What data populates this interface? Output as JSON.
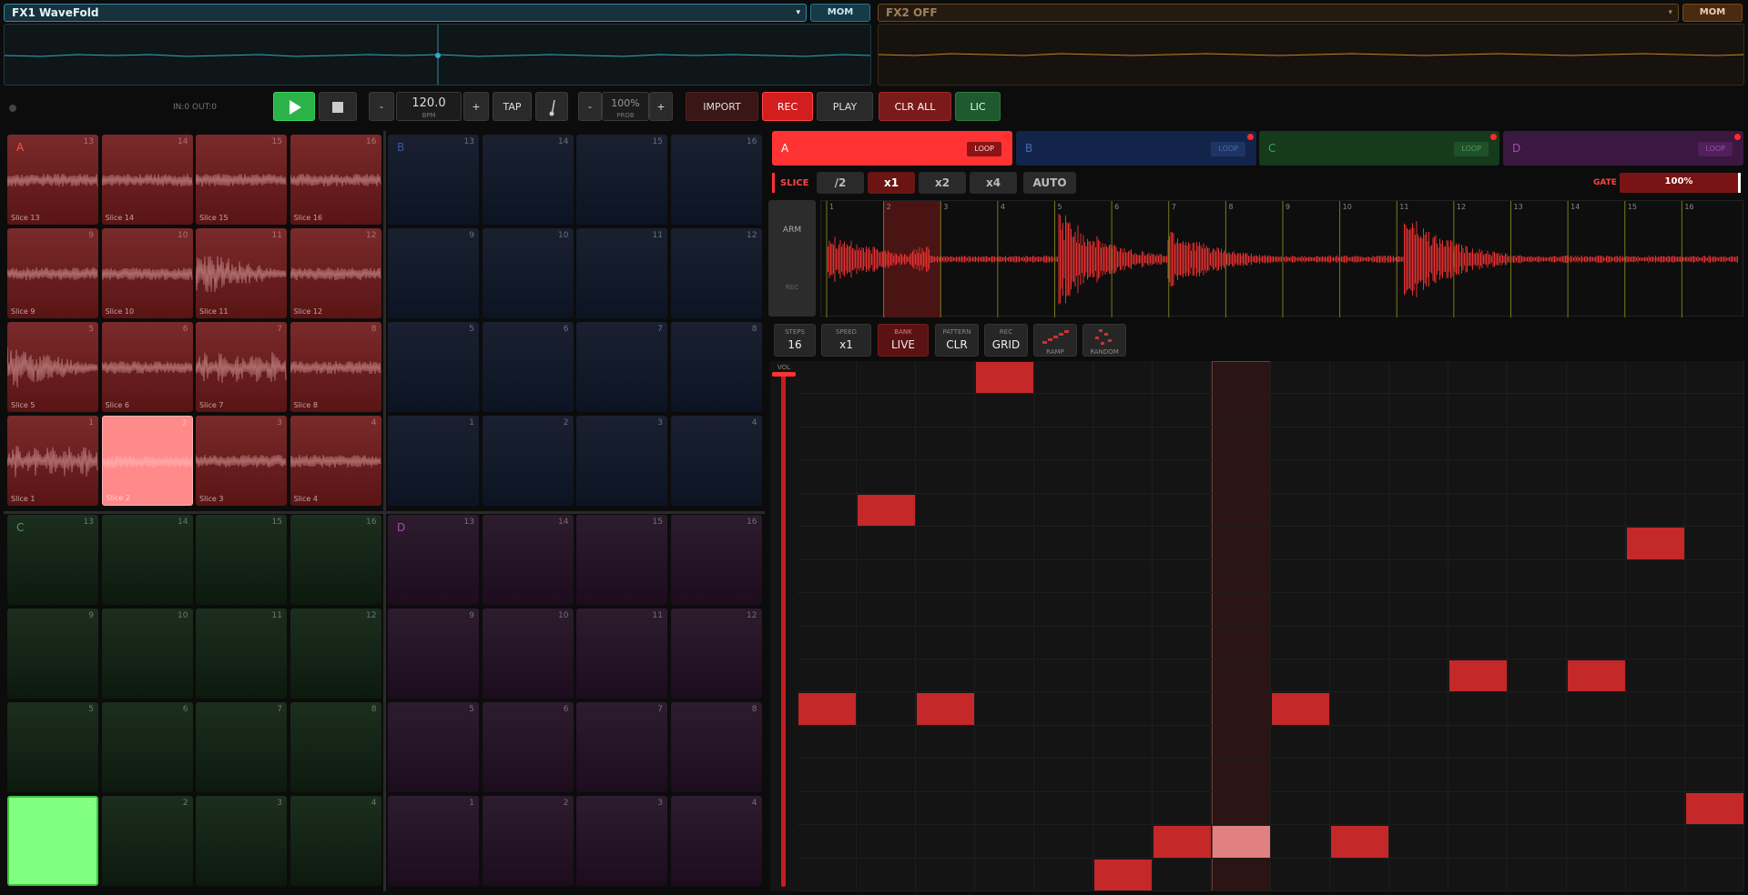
{
  "fx1": {
    "label": "FX1  WaveFold",
    "mom": "MOM"
  },
  "fx2": {
    "label": "FX2  OFF",
    "mom": "MOM"
  },
  "transport": {
    "io": "IN:0 OUT:0",
    "bpm_minus": "-",
    "bpm": "120.0",
    "bpm_unit": "BPM",
    "bpm_plus": "+",
    "tap": "TAP",
    "prob_minus": "-",
    "prob": "100%",
    "prob_unit": "PROB",
    "prob_plus": "+",
    "import": "IMPORT",
    "rec": "REC",
    "play": "PLAY",
    "clr_all": "CLR ALL",
    "lic": "LIC"
  },
  "banks": {
    "a_letter": "A",
    "b_letter": "B",
    "c_letter": "C",
    "d_letter": "D",
    "pad_numbers": [
      "13",
      "14",
      "15",
      "16",
      "9",
      "10",
      "11",
      "12",
      "5",
      "6",
      "7",
      "8",
      "1",
      "2",
      "3",
      "4"
    ],
    "a_slices": [
      "Slice 13",
      "Slice 14",
      "Slice 15",
      "Slice 16",
      "Slice 9",
      "Slice 10",
      "Slice 11",
      "Slice 12",
      "Slice 5",
      "Slice 6",
      "Slice 7",
      "Slice 8",
      "Slice 1",
      "Slice 2",
      "Slice 3",
      "Slice 4"
    ]
  },
  "tabs": [
    {
      "letter": "A",
      "loop": "LOOP"
    },
    {
      "letter": "B",
      "loop": "LOOP"
    },
    {
      "letter": "C",
      "loop": "LOOP"
    },
    {
      "letter": "D",
      "loop": "LOOP"
    }
  ],
  "slice": {
    "label": "SLICE",
    "div2": "/2",
    "x1": "x1",
    "x2": "x2",
    "x4": "x4",
    "auto": "AUTO",
    "gate_label": "GATE",
    "gate": "100%"
  },
  "waveform": {
    "arm": "ARM",
    "rec": "REC",
    "markers": [
      "1",
      "2",
      "3",
      "4",
      "5",
      "6",
      "7",
      "8",
      "9",
      "10",
      "11",
      "12",
      "13",
      "14",
      "15",
      "16"
    ]
  },
  "controls": {
    "steps_title": "STEPS",
    "steps": "16",
    "speed_title": "SPEED",
    "speed": "x1",
    "bank_title": "BANK",
    "bank": "LIVE",
    "pattern_title": "PATTERN",
    "pattern": "CLR",
    "rec_title": "REC",
    "rec": "GRID",
    "ramp": "RAMP",
    "random": "RANDOM"
  },
  "sequencer": {
    "vol_label": "VOL",
    "steps": 16,
    "rows": 16,
    "playhead_step": 7,
    "cells": [
      [
        3,
        0
      ],
      [
        1,
        4
      ],
      [
        14,
        5
      ],
      [
        11,
        9
      ],
      [
        13,
        9
      ],
      [
        0,
        10
      ],
      [
        2,
        10
      ],
      [
        8,
        10
      ],
      [
        15,
        13
      ],
      [
        6,
        14
      ],
      [
        7,
        14
      ],
      [
        9,
        14
      ],
      [
        5,
        15
      ]
    ]
  },
  "colors": {
    "bank_a": "#ff3333",
    "bank_b": "#1e3a6e",
    "bank_c": "#1e5a2a",
    "bank_d": "#5a1e5a",
    "fx1": "#35a8c8",
    "fx2": "#c88030"
  }
}
